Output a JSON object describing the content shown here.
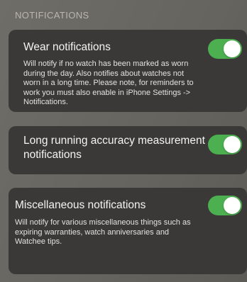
{
  "section_header": "NOTIFICATIONS",
  "items": [
    {
      "title": "Wear notifications",
      "description": "Will notify if no watch has been marked as worn during the day. Also notifies about watches not worn in a long time. Please note, for reminders to work you must also enable in iPhone Settings -> Notifications.",
      "enabled": true
    },
    {
      "title_line1": "Long running accuracy measurement",
      "title_line2": "notifications",
      "enabled": true
    },
    {
      "title": "Miscellaneous notifications",
      "description": "Will notify for various miscellaneous things such as expiring warranties, watch anniversaries and Watchee tips.",
      "enabled": true
    }
  ],
  "colors": {
    "toggle_on": "#4caf50",
    "card_background": "#3a3937"
  }
}
